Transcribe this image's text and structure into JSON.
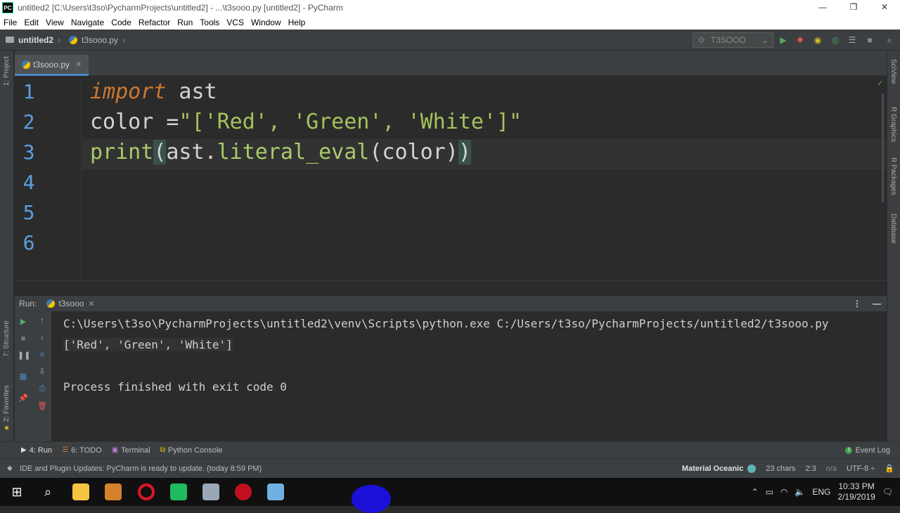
{
  "window": {
    "title": "untitled2 [C:\\Users\\t3so\\PycharmProjects\\untitled2] - ...\\t3sooo.py [untitled2] - PyCharm",
    "app_icon": "PC",
    "controls": [
      "—",
      "❐",
      "✕"
    ]
  },
  "menu": [
    "File",
    "Edit",
    "View",
    "Navigate",
    "Code",
    "Refactor",
    "Run",
    "Tools",
    "VCS",
    "Window",
    "Help"
  ],
  "breadcrumb": {
    "project": "untitled2",
    "file": "t3sooo.py"
  },
  "run_config": {
    "selected": "T3SOOO"
  },
  "left_strip": {
    "project": "1: Project",
    "structure": "7: Structure",
    "favorites": "2: Favorites"
  },
  "right_strip": {
    "sciview": "SciView",
    "r_graphics": "R Graphics",
    "r_packages": "R Packages",
    "database": "Database"
  },
  "editor": {
    "tab_label": "t3sooo.py",
    "line_numbers": [
      "1",
      "2",
      "3",
      "4",
      "5",
      "6"
    ],
    "line1": {
      "kw": "import",
      "rest": " ast"
    },
    "line2": {
      "pre": "color =",
      "str": "\"['Red', 'Green', 'White']\""
    },
    "line3": {
      "fn": "print",
      "open": "(",
      "mid1": "ast.",
      "fn2": "literal_eval",
      "mid2": "(color)",
      "close": ")"
    }
  },
  "run_panel": {
    "label": "Run:",
    "tab_label": "t3sooo",
    "command": "C:\\Users\\t3so\\PycharmProjects\\untitled2\\venv\\Scripts\\python.exe C:/Users/t3so/PycharmProjects/untitled2/t3sooo.py",
    "output": "['Red', 'Green', 'White']",
    "exit_message": "Process finished with exit code 0"
  },
  "tool_windows": {
    "run": "4: Run",
    "todo": "6: TODO",
    "terminal": "Terminal",
    "python_console": "Python Console",
    "event_log": "Event Log"
  },
  "status": {
    "message": "IDE and Plugin Updates: PyCharm is ready to update. (today 8:59 PM)",
    "theme": "Material Oceanic",
    "chars": "23 chars",
    "position": "2:3",
    "na": "n/a",
    "encoding": "UTF-8 ÷"
  },
  "taskbar": {
    "lang": "ENG",
    "time": "10:33 PM",
    "date": "2/19/2019"
  }
}
